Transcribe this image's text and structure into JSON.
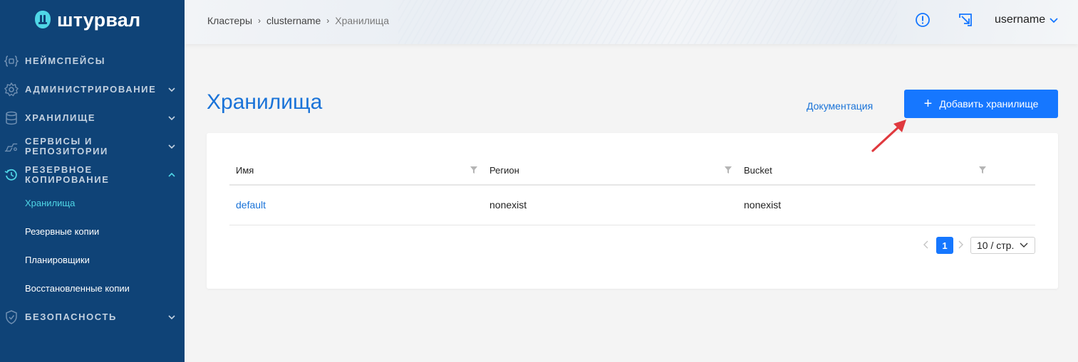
{
  "brand": {
    "name": "штурвал"
  },
  "sidebar": {
    "items": [
      {
        "label": "НЕЙМСПЕЙСЫ",
        "icon": "namespace-icon"
      },
      {
        "label": "АДМИНИСТРИРОВАНИЕ",
        "icon": "gear-icon"
      },
      {
        "label": "ХРАНИЛИЩЕ",
        "icon": "database-icon"
      },
      {
        "label": "СЕРВИСЫ И РЕПОЗИТОРИИ",
        "line1": "СЕРВИСЫ И",
        "line2": "РЕПОЗИТОРИИ",
        "icon": "services-icon"
      },
      {
        "label": "РЕЗЕРВНОЕ КОПИРОВАНИЕ",
        "line1": "РЕЗЕРВНОЕ",
        "line2": "КОПИРОВАНИЕ",
        "icon": "backup-icon",
        "expanded": true
      },
      {
        "label": "БЕЗОПАСНОСТЬ",
        "icon": "shield-icon"
      }
    ],
    "backup_subitems": [
      {
        "label": "Хранилища",
        "active": true
      },
      {
        "label": "Резервные копии"
      },
      {
        "label": "Планировщики"
      },
      {
        "label": "Восстановленные копии"
      }
    ]
  },
  "header": {
    "breadcrumbs": [
      "Кластеры",
      "clustername",
      "Хранилища"
    ],
    "username": "username"
  },
  "main": {
    "title": "Хранилища",
    "doc_link": "Документация",
    "add_button": "Добавить хранилище",
    "table": {
      "columns": [
        "Имя",
        "Регион",
        "Bucket"
      ],
      "rows": [
        {
          "name": "default",
          "region": "nonexist",
          "bucket": "nonexist"
        }
      ]
    },
    "pagination": {
      "current_page": "1",
      "page_size": "10 / стр."
    }
  },
  "colors": {
    "sidebar_bg": "#0f4377",
    "accent": "#1677ff",
    "active_sub": "#4fd6e6",
    "annotation_arrow": "#e0393e"
  }
}
